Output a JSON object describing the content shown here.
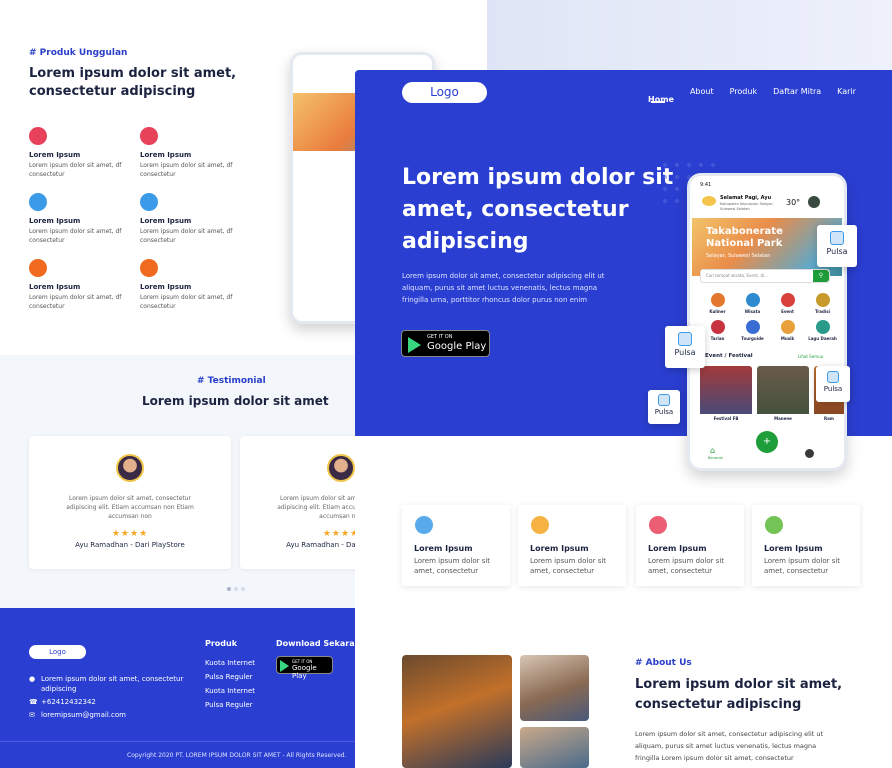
{
  "left": {
    "produk_tag": "# Produk Unggulan",
    "produk_heading_1": "Lorem ipsum dolor sit amet,",
    "produk_heading_2": "consectetur adipiscing",
    "features": [
      {
        "title": "Lorem Ipsum",
        "desc1": "Lorem ipsum dolor sit amet, df",
        "desc2": "consectetur",
        "color": "#e8425a"
      },
      {
        "title": "Lorem Ipsum",
        "desc1": "Lorem ipsum dolor sit amet, df",
        "desc2": "consectetur",
        "color": "#e8425a"
      },
      {
        "title": "Lorem Ipsum",
        "desc1": "Lorem ipsum dolor sit amet, df",
        "desc2": "consectetur",
        "color": "#3c9be8"
      },
      {
        "title": "Lorem Ipsum",
        "desc1": "Lorem ipsum dolor sit amet, df",
        "desc2": "consectetur",
        "color": "#3c9be8"
      },
      {
        "title": "Lorem Ipsum",
        "desc1": "Lorem ipsum dolor sit amet, df",
        "desc2": "consectetur",
        "color": "#ef6a1f"
      },
      {
        "title": "Lorem Ipsum",
        "desc1": "Lorem ipsum dolor sit amet, df",
        "desc2": "consectetur",
        "color": "#ef6a1f"
      }
    ],
    "testi_tag": "# Testimonial",
    "testi_heading": "Lorem ipsum dolor sit amet",
    "testimonials": [
      {
        "line1": "Lorem ipsum dolor sit amet, consectetur",
        "line2": "adipiscing elit. Etiam accumsan non Etiam",
        "line3": "accumsan non",
        "stars": "★★★★",
        "name": "Ayu Ramadhan - Dari PlayStore"
      },
      {
        "line1": "Lorem ipsum dolor sit amet, consectetur",
        "line2": "adipiscing elit. Etiam accumsan non Etiam",
        "line3": "accumsan non",
        "stars": "★★★★",
        "name": "Ayu Ramadhan - Dari PlayStore"
      }
    ],
    "footer": {
      "logo": "Logo",
      "address1": "Lorem ipsum dolor sit amet, consectetur",
      "address2": "adipiscing",
      "phone": "+62412432342",
      "email": "loremipsum@gmail.com",
      "produk_head": "Produk",
      "produk_links": [
        "Kuota Internet",
        "Pulsa Reguler",
        "Kuota Internet",
        "Pulsa Reguler"
      ],
      "download_head": "Download Sekarang",
      "gplay_small": "GET IT ON",
      "gplay_big": "Google Play",
      "copyright": "Copyright 2020 PT. LOREM IPSUM DOLOR SIT AMET - All Rights Reserved."
    }
  },
  "main": {
    "logo": "Logo",
    "nav": [
      "Home",
      "About",
      "Produk",
      "Daftar Mitra",
      "Karir"
    ],
    "hero_heading_1": "Lorem ipsum dolor sit",
    "hero_heading_2": "amet, consectetur",
    "hero_heading_3": "adipiscing",
    "hero_p1": "Lorem ipsum dolor sit amet, consectetur adipiscing elit ut",
    "hero_p2": "aliquam, purus sit amet luctus venenatis, lectus magna",
    "hero_p3": "fringilla urna, porttitor rhoncus dolor purus non enim",
    "gplay_small": "GET IT ON",
    "gplay_big": "Google Play",
    "phone": {
      "time": "9:41",
      "greeting": "Selamat Pagi, Ayu",
      "location": "Kabupaten Kepulauan Selayar, Sulawesi Selatan",
      "temp": "30°",
      "banner_title_1": "Takabonerate",
      "banner_title_2": "National Park",
      "banner_loc": "Selayar, Sulawesi Selatan",
      "search_placeholder": "Cari tempat wisata, Event, di...",
      "categories": [
        "Kuliner",
        "Wisata",
        "Event",
        "Tradisi",
        "Tarian",
        "Tourguide",
        "Musik",
        "Lagu Daerah"
      ],
      "section_title": "Event / Festival",
      "see_all": "Lihat Semua",
      "events": [
        "Festival FB",
        "Manene",
        "Ram"
      ],
      "nav_home": "Beranda"
    },
    "pulsa_labels": [
      "Pulsa",
      "Pulsa",
      "Pulsa",
      "Pulsa"
    ],
    "services": [
      {
        "title": "Lorem Ipsum",
        "desc1": "Lorem ipsum dolor sit",
        "desc2": "amet, consectetur",
        "color": "#3c9be8"
      },
      {
        "title": "Lorem Ipsum",
        "desc1": "Lorem ipsum dolor sit",
        "desc2": "amet, consectetur",
        "color": "#f5a623"
      },
      {
        "title": "Lorem Ipsum",
        "desc1": "Lorem ipsum dolor sit",
        "desc2": "amet, consectetur",
        "color": "#e8425a"
      },
      {
        "title": "Lorem Ipsum",
        "desc1": "Lorem ipsum dolor sit",
        "desc2": "amet, consectetur",
        "color": "#5cb83a"
      }
    ],
    "about_tag": "# About Us",
    "about_heading_1": "Lorem ipsum dolor sit amet,",
    "about_heading_2": "consectetur adipiscing",
    "about_p1": "Lorem ipsum dolor sit amet, consectetur adipiscing elit ut",
    "about_p2": "aliquam, purus sit amet luctus venenatis, lectus magna",
    "about_p3": "fringilla Lorem ipsum dolor sit amet, consectetur"
  },
  "colors": {
    "primary": "#2a3fd1",
    "accent_green": "#1e9e3a",
    "star": "#f5a623"
  }
}
